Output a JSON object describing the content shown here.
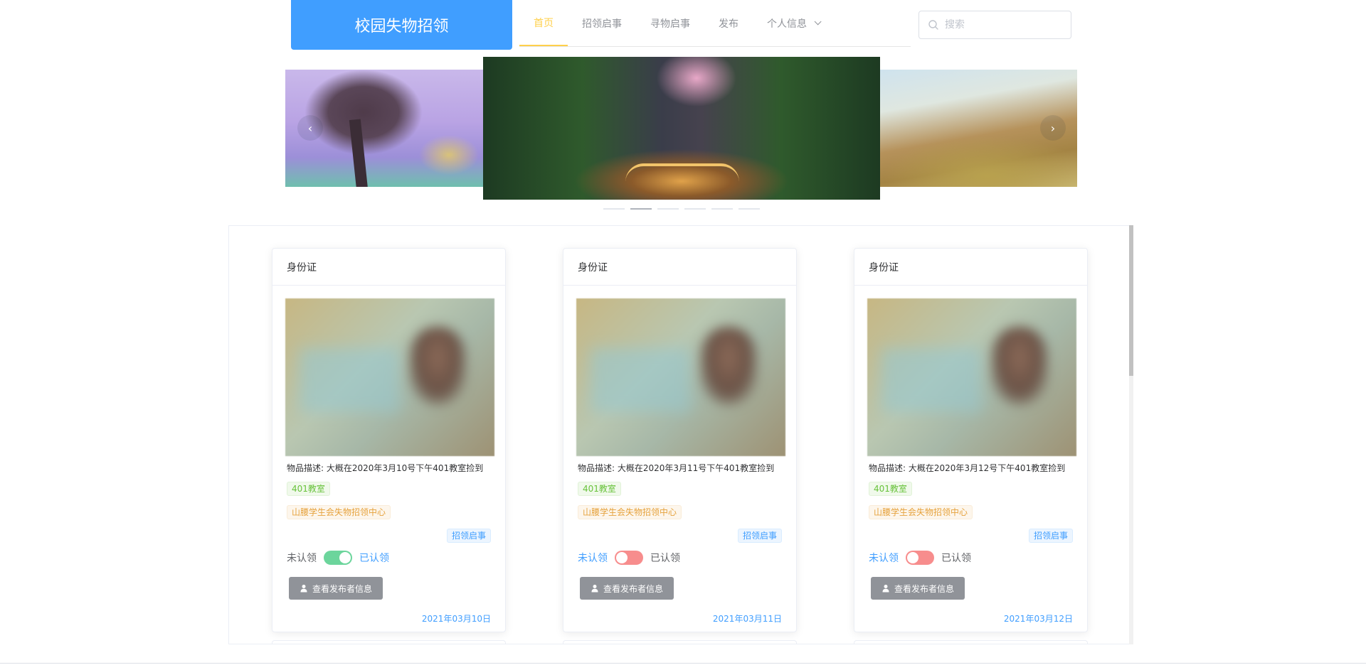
{
  "header": {
    "logo": "校园失物招领",
    "nav": [
      {
        "label": "首页",
        "active": true
      },
      {
        "label": "招领启事",
        "active": false
      },
      {
        "label": "寻物启事",
        "active": false
      },
      {
        "label": "发布",
        "active": false
      },
      {
        "label": "个人信息",
        "active": false,
        "dropdown": true
      }
    ],
    "search_placeholder": "搜索"
  },
  "carousel": {
    "active_index": 1,
    "indicator_count": 6
  },
  "cards": [
    {
      "title": "身份证",
      "description": "物品描述: 大概在2020年3月10号下午401教室捡到",
      "location_tag": "401教室",
      "publisher_tag": "山腰学生会失物招领中心",
      "type_tag": "招领启事",
      "switch_off_label": "未认领",
      "switch_on_label": "已认领",
      "claimed": true,
      "switch_color": "#6cd59c",
      "button_label": "查看发布者信息",
      "date": "2021年03月10日"
    },
    {
      "title": "身份证",
      "description": "物品描述: 大概在2020年3月11号下午401教室捡到",
      "location_tag": "401教室",
      "publisher_tag": "山腰学生会失物招领中心",
      "type_tag": "招领启事",
      "switch_off_label": "未认领",
      "switch_on_label": "已认领",
      "claimed": false,
      "switch_color": "#f78d8d",
      "button_label": "查看发布者信息",
      "date": "2021年03月11日"
    },
    {
      "title": "身份证",
      "description": "物品描述: 大概在2020年3月12号下午401教室捡到",
      "location_tag": "401教室",
      "publisher_tag": "山腰学生会失物招领中心",
      "type_tag": "招领启事",
      "switch_off_label": "未认领",
      "switch_on_label": "已认领",
      "claimed": false,
      "switch_color": "#f78d8d",
      "button_label": "查看发布者信息",
      "date": "2021年03月12日"
    }
  ],
  "colors": {
    "primary": "#409eff",
    "nav_active": "#ffd04b",
    "button_gray": "#909399"
  }
}
